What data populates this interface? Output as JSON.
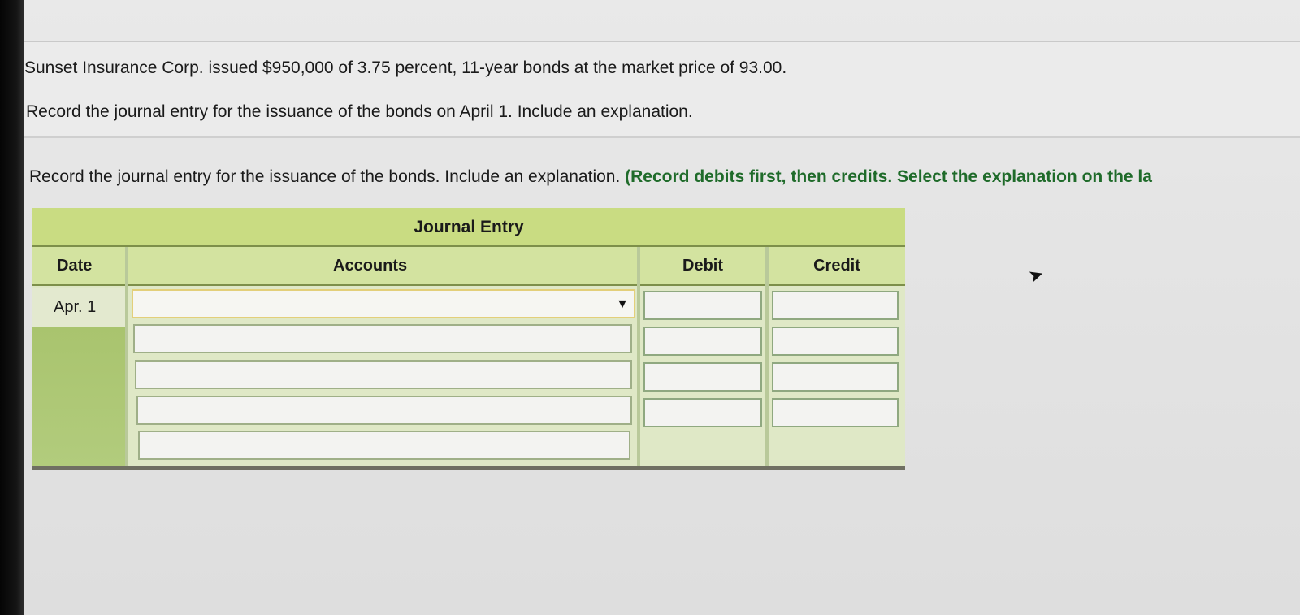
{
  "question": {
    "line1": "Sunset Insurance Corp. issued $950,000 of 3.75 percent, 11-year bonds at the market price of 93.00.",
    "line2": "Record the journal entry for the issuance of the bonds on April 1. Include an explanation."
  },
  "instruction": {
    "prefix": "Record the journal entry for the issuance of the bonds. Include an explanation. ",
    "highlight": "(Record debits first, then credits. Select the explanation on the la"
  },
  "journal": {
    "title": "Journal Entry",
    "headers": {
      "date": "Date",
      "accounts": "Accounts",
      "debit": "Debit",
      "credit": "Credit"
    },
    "date_value": "Apr. 1",
    "rows": [
      {
        "account": "",
        "debit": "",
        "credit": "",
        "dropdown": true
      },
      {
        "account": "",
        "debit": "",
        "credit": ""
      },
      {
        "account": "",
        "debit": "",
        "credit": ""
      },
      {
        "account": "",
        "debit": "",
        "credit": ""
      },
      {
        "account": ""
      }
    ]
  },
  "icons": {
    "dropdown": "triangle-down-icon",
    "cursor": "mouse-pointer-icon"
  },
  "colors": {
    "title_bar": "#c9dc82",
    "header": "#d3e3a0",
    "instruction_green": "#1f6b2a"
  }
}
